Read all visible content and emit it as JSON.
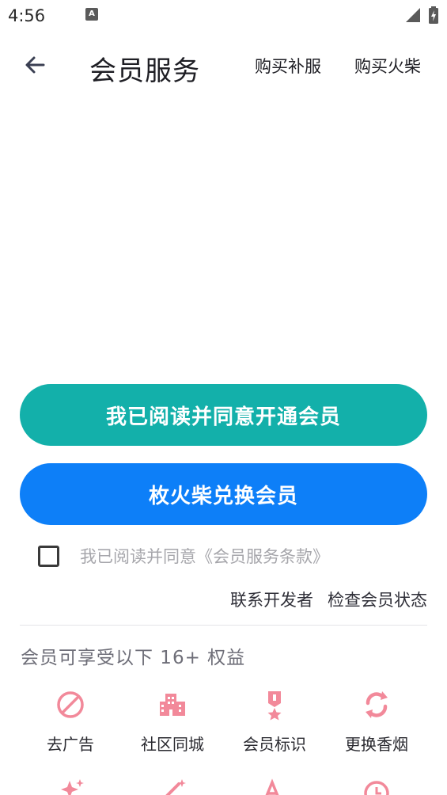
{
  "status_bar": {
    "time": "4:56",
    "notification_glyph": "A"
  },
  "header": {
    "title": "会员服务",
    "action_buy_refill": "购买补服",
    "action_buy_matches": "购买火柴"
  },
  "buttons": {
    "agree_open": "我已阅读并同意开通会员",
    "exchange": "枚火柴兑换会员"
  },
  "agreement": {
    "text": "我已阅读并同意《会员服务条款》",
    "checked": false
  },
  "links": {
    "contact_dev": "联系开发者",
    "check_status": "检查会员状态"
  },
  "benefits": {
    "heading": "会员可享受以下 16+ 权益",
    "items": [
      {
        "label": "去广告",
        "icon": "no-ads-icon"
      },
      {
        "label": "社区同城",
        "icon": "city-icon"
      },
      {
        "label": "会员标识",
        "icon": "badge-icon"
      },
      {
        "label": "更换香烟",
        "icon": "swap-icon"
      }
    ]
  },
  "colors": {
    "primary_teal": "#13b0aa",
    "primary_blue": "#0d7ff8",
    "icon_pink": "#f2899a"
  }
}
